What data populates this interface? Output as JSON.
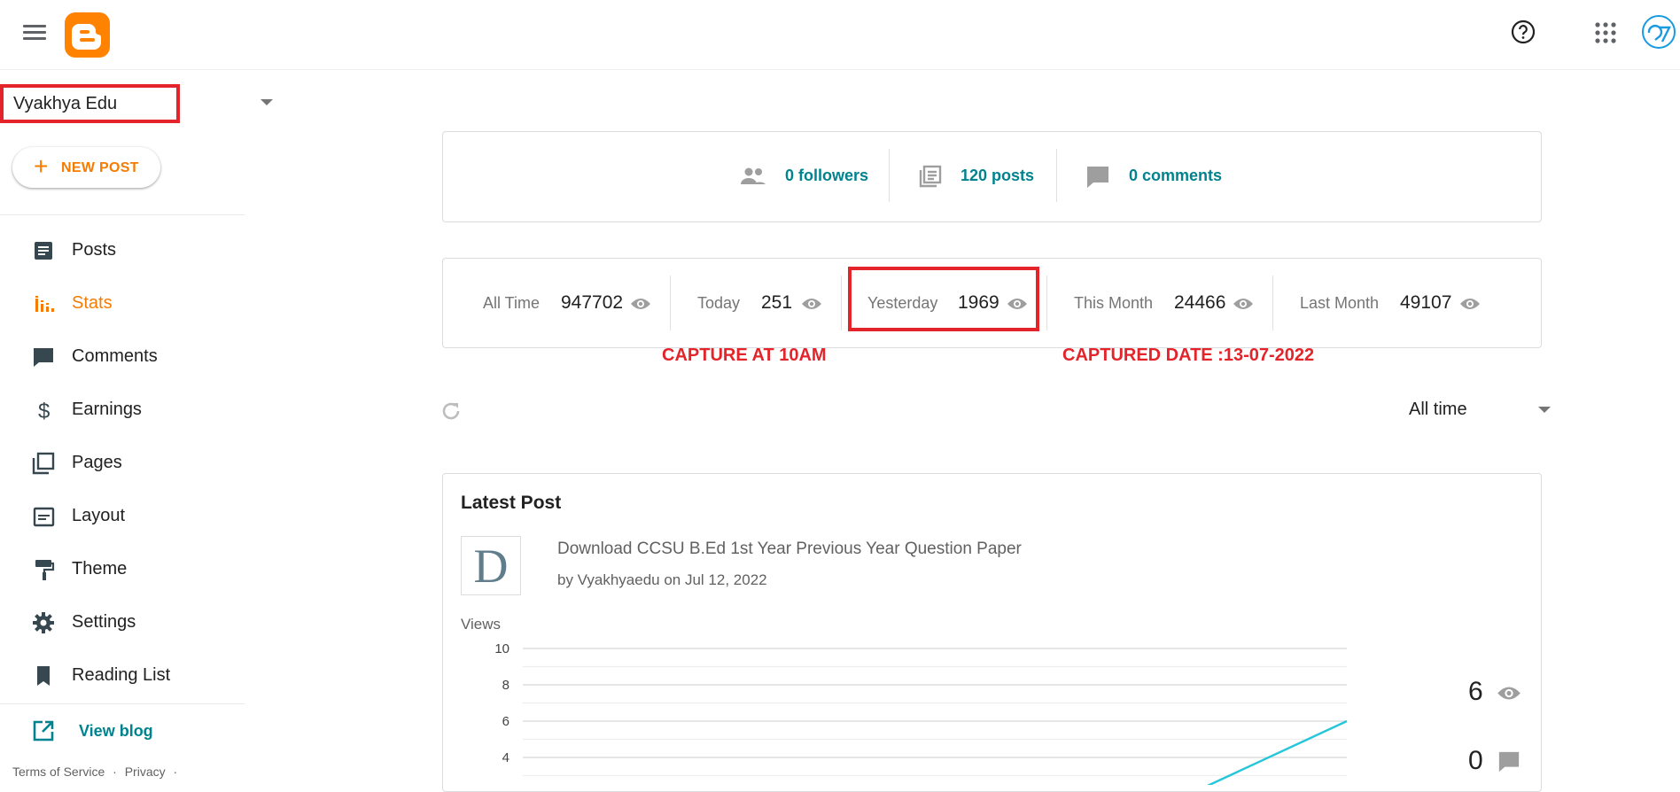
{
  "topbar": {
    "menu_icon": "hamburger-menu-icon",
    "logo_icon": "blogger-logo-icon",
    "help_icon": "help-circle-icon",
    "apps_icon": "apps-grid-icon",
    "avatar_icon": "account-avatar-icon"
  },
  "sidebar": {
    "blog_name": "Vyakhya Edu",
    "new_post_label": "NEW POST",
    "items": [
      {
        "label": "Posts",
        "icon": "posts-icon"
      },
      {
        "label": "Stats",
        "icon": "stats-icon",
        "active": true
      },
      {
        "label": "Comments",
        "icon": "comments-icon"
      },
      {
        "label": "Earnings",
        "icon": "dollar-icon"
      },
      {
        "label": "Pages",
        "icon": "pages-icon"
      },
      {
        "label": "Layout",
        "icon": "layout-icon"
      },
      {
        "label": "Theme",
        "icon": "paint-roller-icon"
      },
      {
        "label": "Settings",
        "icon": "gear-icon"
      },
      {
        "label": "Reading List",
        "icon": "bookmark-icon"
      }
    ],
    "view_blog_label": "View blog",
    "footer": {
      "terms": "Terms of Service",
      "sep": "·",
      "privacy": "Privacy",
      "sep2": "·"
    }
  },
  "summary": {
    "followers": "0 followers",
    "posts": "120 posts",
    "comments": "0 comments"
  },
  "stats": [
    {
      "label": "All Time",
      "value": "947702"
    },
    {
      "label": "Today",
      "value": "251"
    },
    {
      "label": "Yesterday",
      "value": "1969"
    },
    {
      "label": "This Month",
      "value": "24466"
    },
    {
      "label": "Last Month",
      "value": "49107"
    }
  ],
  "annotations": {
    "left": "CAPTURE AT 10AM",
    "right": "CAPTURED DATE :13-07-2022"
  },
  "range": {
    "selected": "All time"
  },
  "latest": {
    "title": "Latest Post",
    "thumb_letter": "D",
    "post_title": "Download CCSU B.Ed 1st Year Previous Year Question Paper",
    "post_meta": "by Vyakhyaedu on Jul 12, 2022",
    "views_label": "Views",
    "views_count": "6",
    "comments_count": "0"
  },
  "colors": {
    "accent": "#f57c00",
    "link": "#00838f",
    "annotation_red": "#e3242b",
    "chart_line": "#26c6da"
  },
  "chart_data": {
    "type": "line",
    "ylabel": "Views",
    "ylim": [
      0,
      10
    ],
    "yticks": [
      "10",
      "8",
      "6",
      "4"
    ],
    "x": [
      0.81,
      1.0
    ],
    "series": [
      {
        "values": [
          2,
          6
        ]
      }
    ]
  }
}
